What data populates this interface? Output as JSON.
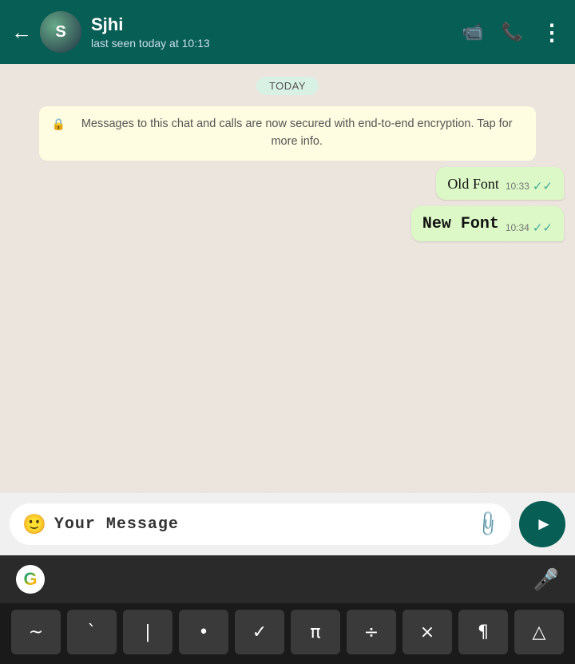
{
  "header": {
    "back_label": "←",
    "name": "Sjhi",
    "status": "last seen today at 10:13",
    "video_icon": "📹",
    "call_icon": "📞",
    "more_icon": "⋮",
    "avatar_initials": "S"
  },
  "chat": {
    "date_badge": "TODAY",
    "encryption_notice": "Messages to this chat and calls are now secured with end-to-end encryption. Tap for more info.",
    "messages": [
      {
        "text": "Old Font",
        "time": "10:33",
        "ticks": "✓✓",
        "font_class": "old-font"
      },
      {
        "text": "New Font",
        "time": "10:34",
        "ticks": "✓✓",
        "font_class": "new-font"
      }
    ]
  },
  "input": {
    "emoji_icon": "🙂",
    "placeholder": "Your Message",
    "attach_icon": "📎",
    "send_icon": "▶"
  },
  "keyboard": {
    "google_g": "G",
    "mic_icon": "🎤",
    "keys": [
      "~",
      "`",
      "|",
      "•",
      "✓",
      "π",
      "÷",
      "×",
      "¶",
      "△"
    ]
  }
}
